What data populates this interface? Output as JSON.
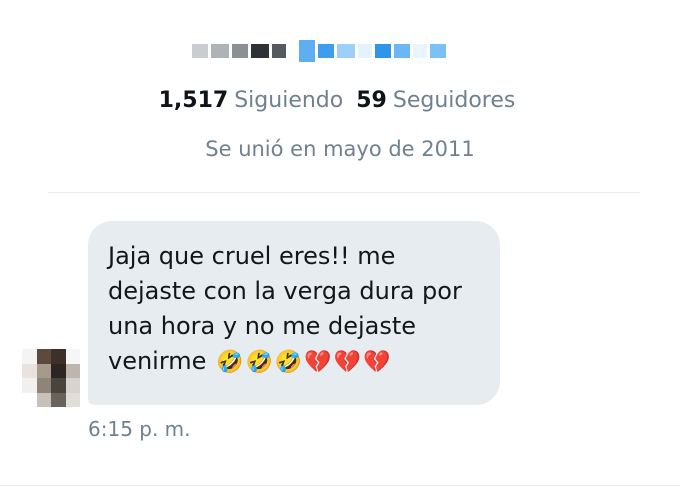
{
  "profile": {
    "following_count": "1,517",
    "following_label": "Siguiendo",
    "followers_count": "59",
    "followers_label": "Seguidores",
    "joined": "Se unió en mayo de 2011"
  },
  "message": {
    "lines": [
      "Jaja que cruel eres!! me",
      "dejaste con la verga dura por",
      "una hora y no me dejaste",
      "venirme"
    ],
    "emojis": [
      "🤣",
      "🤣",
      "🤣",
      "💔",
      "💔",
      "💔"
    ],
    "timestamp": "6:15 p. m."
  },
  "colors": {
    "bubble": "#e6ecf0",
    "muted_text": "#6f8191",
    "link_blue": "#1da1f2"
  }
}
